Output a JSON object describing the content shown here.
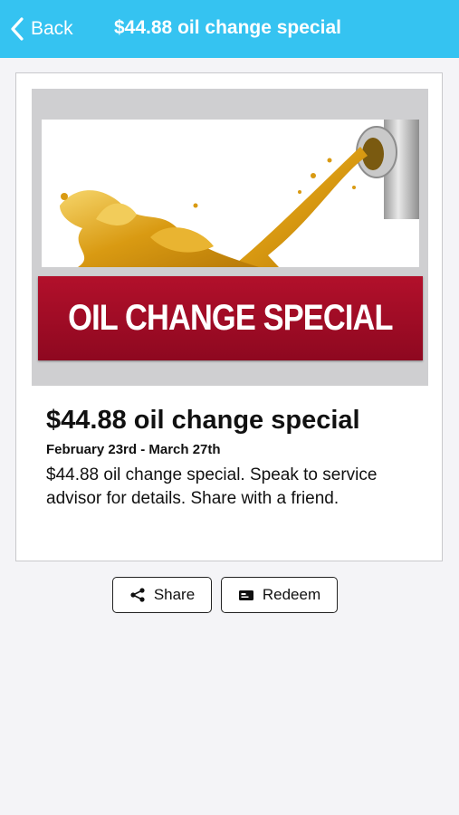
{
  "nav": {
    "back_label": "Back",
    "title": "$44.88 oil change special"
  },
  "promo": {
    "banner_text": "OIL CHANGE SPECIAL",
    "headline": "$44.88 oil change special",
    "dates": "February 23rd - March 27th",
    "description": "$44.88 oil change special. Speak to service advisor for details. Share with a friend."
  },
  "actions": {
    "share_label": "Share",
    "redeem_label": "Redeem"
  },
  "colors": {
    "navbar": "#35c3f1",
    "banner": "#a50d26",
    "oil": "#e0a81c"
  },
  "icons": {
    "back": "chevron-left-icon",
    "share": "share-icon",
    "redeem": "ticket-icon"
  }
}
